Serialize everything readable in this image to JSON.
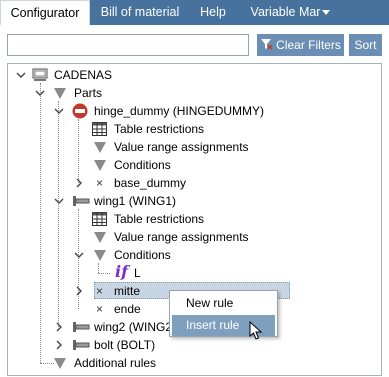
{
  "tabs": [
    {
      "label": "Configurator",
      "active": true
    },
    {
      "label": "Bill of material",
      "active": false
    },
    {
      "label": "Help",
      "active": false
    },
    {
      "label": "Variable Mar",
      "active": false
    }
  ],
  "toolbar": {
    "search_value": "",
    "clear_filters_label": "Clear Filters",
    "sort_label": "Sort"
  },
  "tree": {
    "root": "CADENAS",
    "parts": "Parts",
    "hinge": "hinge_dummy (HINGEDUMMY)",
    "hinge_table": "Table restrictions",
    "hinge_range": "Value range assignments",
    "hinge_conditions": "Conditions",
    "base_dummy": "base_dummy",
    "wing1": "wing1 (WING1)",
    "wing1_table": "Table restrictions",
    "wing1_range": "Value range assignments",
    "wing1_conditions": "Conditions",
    "if_keyword": "if",
    "if_value": "L",
    "mitte": "mitte",
    "ende": "ende",
    "wing2": "wing2 (WING2)",
    "bolt": "bolt (BOLT)",
    "additional_rules": "Additional rules"
  },
  "context_menu": {
    "items": [
      "New rule",
      "Insert rule"
    ]
  },
  "colors": {
    "tabbar": "#47729e",
    "button": "#6b8fb4",
    "selection": "#c8d6e4",
    "menu_hover": "#7f9fbf",
    "if_keyword": "#7a2bc9"
  }
}
